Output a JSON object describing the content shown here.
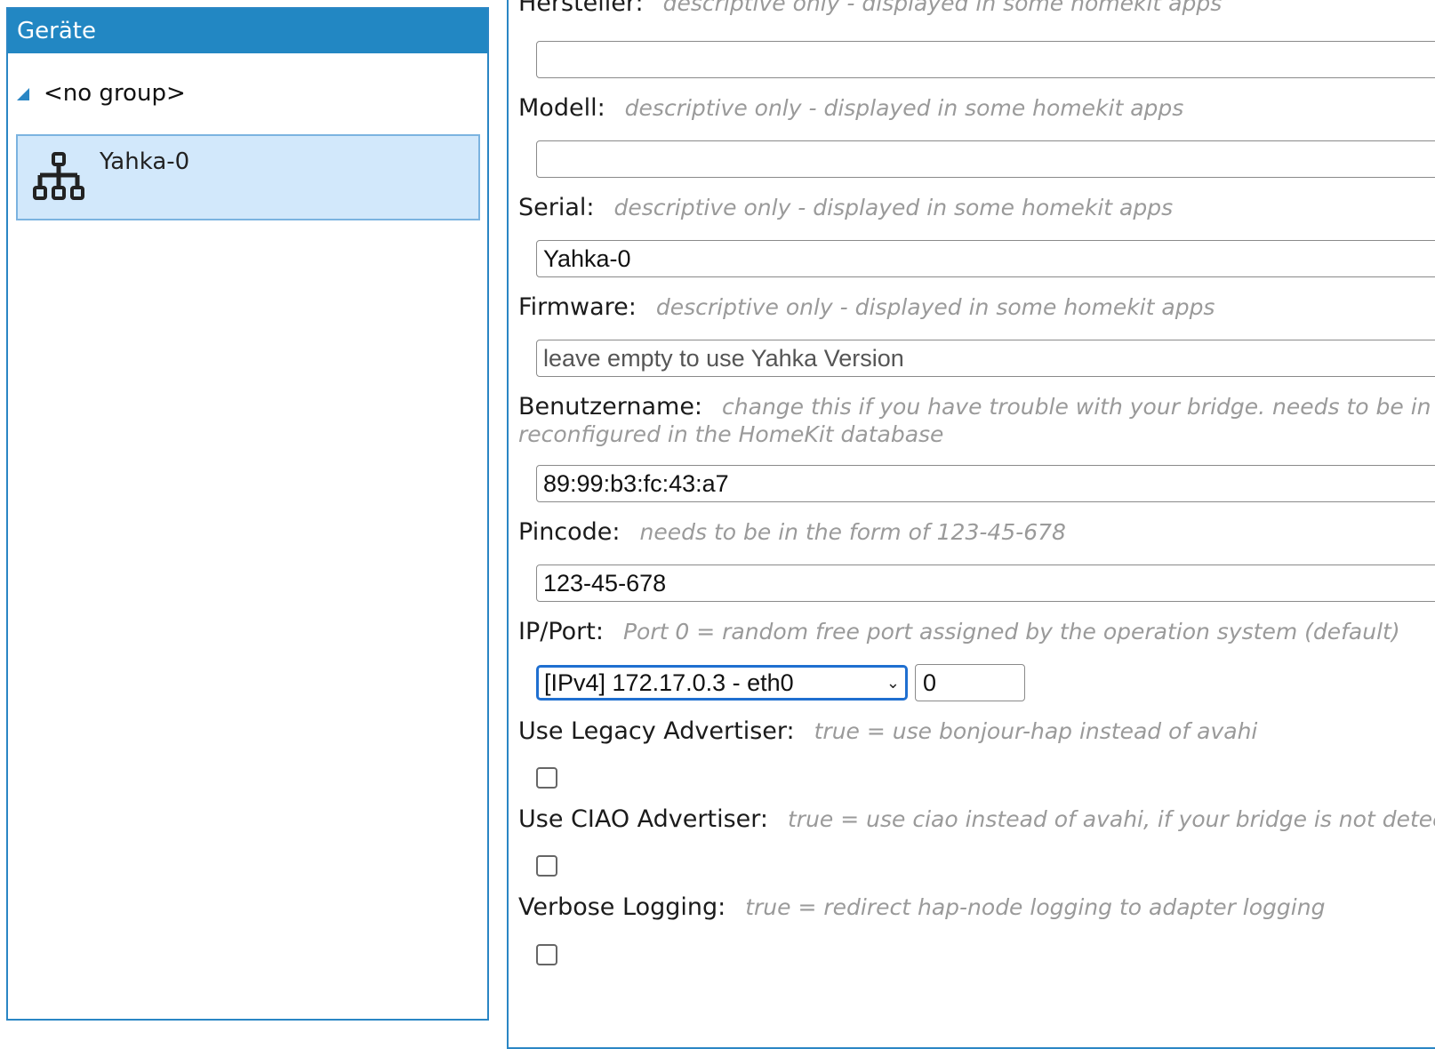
{
  "left": {
    "title": "Geräte",
    "group": "<no group>",
    "device": "Yahka-0",
    "device_icon": "network-tree-icon"
  },
  "form": {
    "manufacturer": {
      "label": "Hersteller:",
      "hint": "descriptive only - displayed in some homekit apps",
      "value": ""
    },
    "model": {
      "label": "Modell:",
      "hint": "descriptive only - displayed in some homekit apps",
      "value": ""
    },
    "serial": {
      "label": "Serial:",
      "hint": "descriptive only - displayed in some homekit apps",
      "value": "Yahka-0"
    },
    "firmware": {
      "label": "Firmware:",
      "hint": "descriptive only - displayed in some homekit apps",
      "placeholder": "leave empty to use Yahka Version",
      "value": ""
    },
    "username": {
      "label": "Benutzername:",
      "hint": "change this if you have trouble with your bridge. needs to be in form",
      "hint2": "reconfigured in the HomeKit database",
      "value": "89:99:b3:fc:43:a7"
    },
    "pincode": {
      "label": "Pincode:",
      "hint": "needs to be in the form of 123-45-678",
      "value": "123-45-678"
    },
    "ipport": {
      "label": "IP/Port:",
      "hint": "Port 0 = random free port assigned by the operation system (default)",
      "selected": "[IPv4] 172.17.0.3 - eth0",
      "port": "0"
    },
    "legacy": {
      "label": "Use Legacy Advertiser:",
      "hint": "true = use bonjour-hap instead of avahi",
      "checked": false
    },
    "ciao": {
      "label": "Use CIAO Advertiser:",
      "hint": "true = use ciao instead of avahi, if your bridge is not detected",
      "checked": false
    },
    "verbose": {
      "label": "Verbose Logging:",
      "hint": "true = redirect hap-node logging to adapter logging",
      "checked": false
    }
  }
}
